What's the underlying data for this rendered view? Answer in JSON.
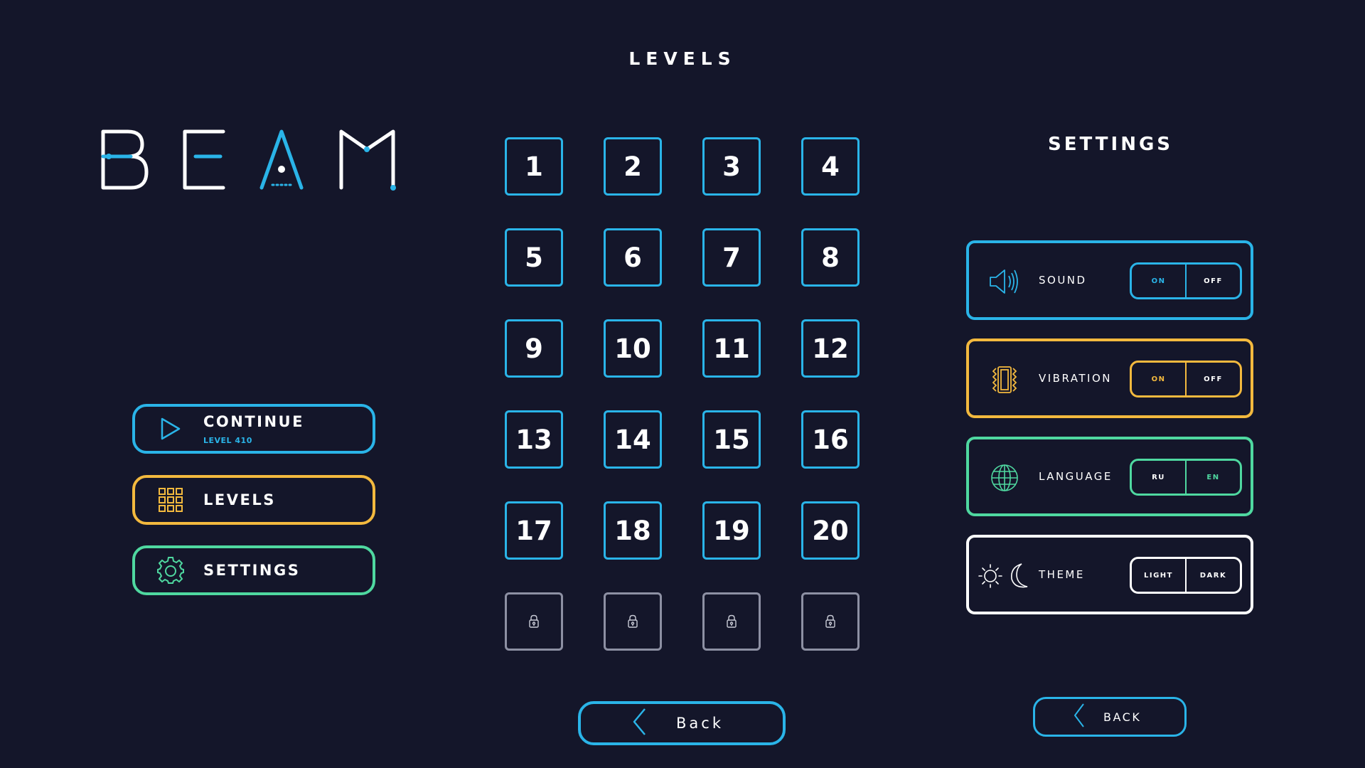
{
  "logo": {
    "text": "BEAM"
  },
  "colors": {
    "background": "#14162a",
    "blue": "#2ab4e8",
    "yellow": "#f3b93e",
    "green": "#4fd8a0",
    "white": "#ffffff",
    "locked": "#8d90a3"
  },
  "menu": {
    "continue": {
      "label": "CONTINUE",
      "sub": "LEVEL 410",
      "icon": "play-icon"
    },
    "levels": {
      "label": "LEVELS",
      "icon": "grid-icon"
    },
    "settings": {
      "label": "SETTINGS",
      "icon": "gear-icon"
    }
  },
  "levels_panel": {
    "title": "LEVELS",
    "items": [
      "1",
      "2",
      "3",
      "4",
      "5",
      "6",
      "7",
      "8",
      "9",
      "10",
      "11",
      "12",
      "13",
      "14",
      "15",
      "16",
      "17",
      "18",
      "19",
      "20"
    ],
    "locked_count": 4,
    "back_label": "Back"
  },
  "settings_panel": {
    "title": "SETTINGS",
    "sound": {
      "label": "SOUND",
      "on": "ON",
      "off": "OFF",
      "icon": "speaker-icon"
    },
    "vibration": {
      "label": "VIBRATION",
      "on": "ON",
      "off": "OFF",
      "icon": "vibration-icon"
    },
    "language": {
      "label": "LANGUAGE",
      "ru": "RU",
      "en": "EN",
      "icon": "globe-icon"
    },
    "theme": {
      "label": "THEME",
      "light": "LIGHT",
      "dark": "DARK",
      "icon": "sun-moon-icon"
    },
    "back_label": "BACK"
  }
}
